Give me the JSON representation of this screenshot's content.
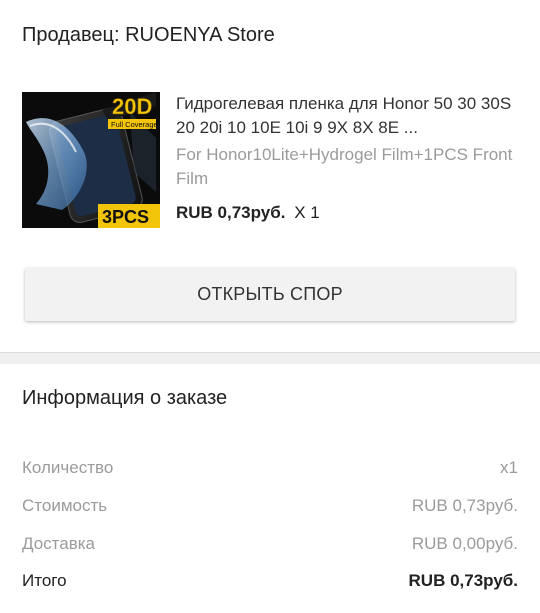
{
  "seller": {
    "label": "Продавец: RUOENYA Store"
  },
  "product": {
    "title": "Гидрогелевая пленка для Honor 50 30 30S 20 20i 10 10E 10i 9 9X 8X 8E ...",
    "variant": "For Honor10Lite+Hydrogel Film+1PCS Front Film",
    "price": "RUB 0,73руб.",
    "quantity": "X 1",
    "image": {
      "badge_top": "20D",
      "badge_sub": "Full Coverage",
      "badge_bottom": "3PCS"
    }
  },
  "actions": {
    "open_dispute": "ОТКРЫТЬ СПОР"
  },
  "order_info": {
    "title": "Информация о заказе",
    "rows": [
      {
        "label": "Количество",
        "value": "x1"
      },
      {
        "label": "Стоимость",
        "value": "RUB 0,73руб."
      },
      {
        "label": "Доставка",
        "value": "RUB 0,00руб."
      },
      {
        "label": "Итого",
        "value": "RUB 0,73руб."
      }
    ]
  },
  "colors": {
    "badge_yellow": "#f2c40a",
    "divider": "#efefef",
    "muted_text": "#9b9b9b"
  }
}
